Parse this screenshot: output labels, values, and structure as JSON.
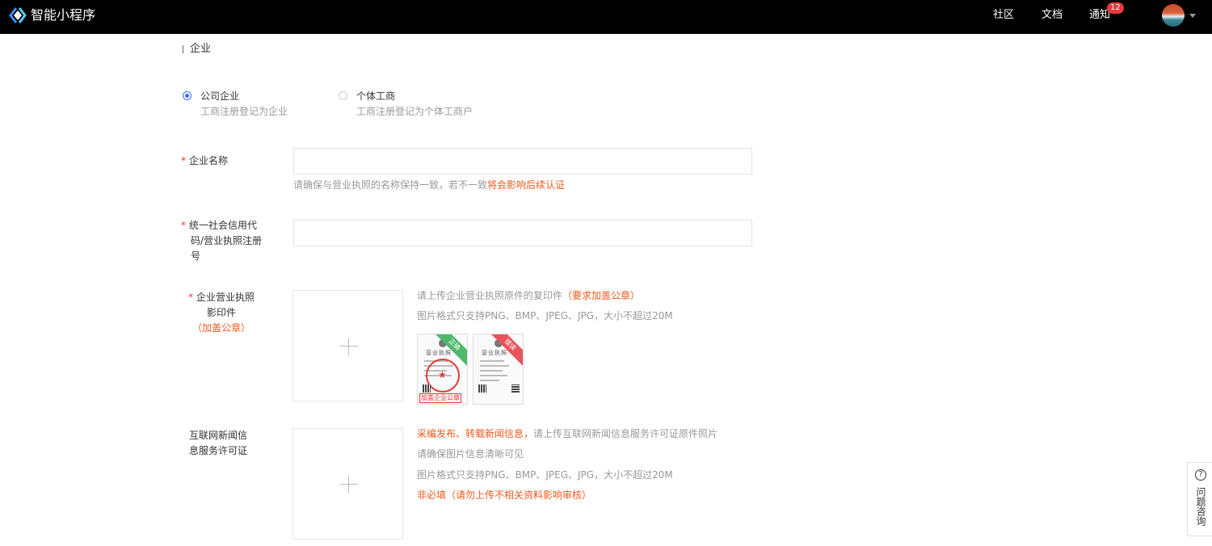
{
  "app": {
    "brand": "智能小程序"
  },
  "nav": {
    "community": "社区",
    "docs": "文档",
    "notify": "通知",
    "notify_count": "12"
  },
  "section": {
    "title": "企业"
  },
  "entity_types": [
    {
      "label": "公司企业",
      "desc": "工商注册登记为企业",
      "checked": true
    },
    {
      "label": "个体工商",
      "desc": "工商注册登记为个体工商户",
      "checked": false
    }
  ],
  "fields": {
    "required_mark": "*",
    "company_name": {
      "label": "企业名称",
      "value": "",
      "hint_prefix": "请确保与营业执照的名称保持一致，若不一致",
      "hint_warn": "将会影响后续认证"
    },
    "credit_code": {
      "label_line1": "统一社会信用代",
      "label_line2": "码/营业执照注册",
      "label_line3": "号",
      "value": ""
    },
    "license": {
      "label_line1": "企业营业执照",
      "label_line2": "影印件",
      "label_note": "（加盖公章）",
      "hint_prefix": "请上传企业营业执照原件的复印件",
      "hint_warn": "（要求加盖公章）",
      "format_hint": "图片格式只支持PNG、BMP、JPEG、JPG，大小不超过20M",
      "samples": [
        {
          "ribbon": "正确",
          "doc_title": "营业执照",
          "stamp": "加盖企业公章"
        },
        {
          "ribbon": "错误",
          "doc_title": "营业执照"
        }
      ]
    },
    "news_permit": {
      "label_line1": "互联网新闻信",
      "label_line2": "息服务许可证",
      "hint_warn": "采编发布、转载新闻信息，",
      "hint_rest": "请上传互联网新闻信息服务许可证原件照片",
      "clarity_hint": "请确保图片信息清晰可见",
      "format_hint": "图片格式只支持PNG、BMP、JPEG、JPG，大小不超过20M",
      "optional_note": "非必填（请勿上传不相关资料影响审核）"
    }
  },
  "help": {
    "label": "问题咨询",
    "icon": "?"
  },
  "colors": {
    "topbar": "#000000",
    "accent": "#3c6ef6",
    "warn": "#f05a1e",
    "required": "#e4393c"
  }
}
